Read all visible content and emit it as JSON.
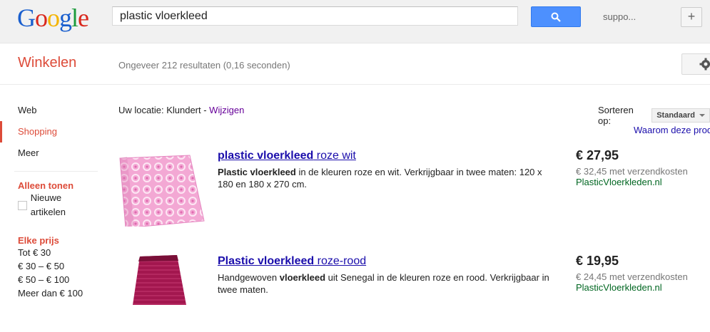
{
  "header": {
    "logo_letters": [
      {
        "char": "G",
        "color": "#1a5fce"
      },
      {
        "char": "o",
        "color": "#d9281d"
      },
      {
        "char": "o",
        "color": "#f4b400"
      },
      {
        "char": "g",
        "color": "#1a5fce"
      },
      {
        "char": "l",
        "color": "#1c9b3c"
      },
      {
        "char": "e",
        "color": "#d9281d"
      }
    ],
    "search_value": "plastic vloerkleed",
    "search_button_icon": "search-icon",
    "user_label": "suppo...",
    "plus_label": "+"
  },
  "subheader": {
    "section_title": "Winkelen",
    "result_stats": "Ongeveer 212 resultaten (0,16 seconden)",
    "settings_icon": "gear-icon"
  },
  "sidebar": {
    "items": [
      {
        "label": "Web",
        "active": false
      },
      {
        "label": "Shopping",
        "active": true
      },
      {
        "label": "Meer",
        "active": false
      }
    ],
    "filter1_heading": "Alleen tonen",
    "filter1_checkbox_label": "Nieuwe artikelen",
    "filter2_heading": "Elke prijs",
    "price_filters": [
      "Tot € 30",
      "€ 30 – € 50",
      "€ 50 – € 100",
      "Meer dan € 100"
    ]
  },
  "toolbar": {
    "location_label": "Uw locatie: Klundert - ",
    "location_change": "Wijzigen",
    "sort_label": "Sorteren op:",
    "sort_value": "Standaard",
    "why_label": "Waarom deze prod"
  },
  "results": [
    {
      "title_bold": "plastic vloerkleed",
      "title_rest": " roze wit",
      "desc_bold": "Plastic vloerkleed",
      "desc_rest": " in de kleuren roze en wit. Verkrijgbaar in twee maten: 120 x 180 en 180 x 270 cm.",
      "price": "€ 27,95",
      "shipping": "€ 32,45 met verzendkosten",
      "shop": "PlasticVloerkleden.nl"
    },
    {
      "title_bold": "Plastic vloerkleed",
      "title_rest": " roze-rood",
      "desc_pre": "Handgewoven ",
      "desc_bold": "vloerkleed",
      "desc_rest": " uit Senegal in de kleuren roze en rood. Verkrijgbaar in twee maten.",
      "price": "€ 19,95",
      "shipping": "€ 24,45 met verzendkosten",
      "shop": "PlasticVloerkleden.nl"
    }
  ]
}
